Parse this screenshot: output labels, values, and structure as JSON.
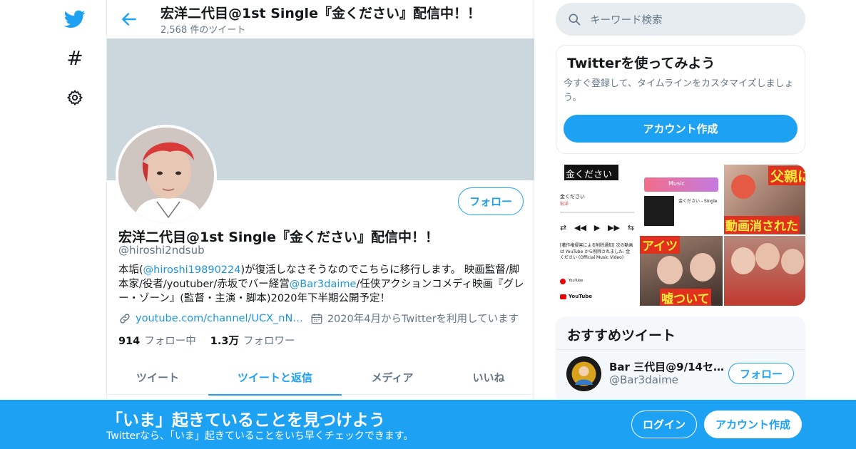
{
  "colors": {
    "accent": "#1da1f2",
    "banner": "#ccd6dd",
    "text_secondary": "#657786",
    "link": "#1b95e0"
  },
  "nav": {
    "items": [
      {
        "icon": "twitter-logo-icon"
      },
      {
        "icon": "hashtag-icon",
        "glyph": "#"
      },
      {
        "icon": "gear-icon"
      }
    ]
  },
  "header": {
    "back_icon": "arrow-left-icon",
    "title": "宏洋二代目@1st Single『金ください』配信中！！",
    "tweet_count": "2,568 件のツイート"
  },
  "profile": {
    "follow_label": "フォロー",
    "name": "宏洋二代目@1st Single『金ください』配信中！！",
    "handle": "@hiroshi2ndsub",
    "bio": {
      "p1": "本垢(",
      "link1": "@hiroshi19890224",
      "p2": ")が復活しなさそうなのでこちらに移行します。 映画監督/脚本家/役者/youtuber/赤坂でバー経営",
      "link2": "@Bar3daime",
      "p3": "/任侠アクションコメディ映画『グレー・ゾーン』(監督・主演・脚本)2020年下半期公開予定！"
    },
    "website": "youtube.com/channel/UCX_nN…",
    "joined": "2020年4月からTwitterを利用しています",
    "following_count": "914",
    "following_label": "フォロー中",
    "followers_count": "1.3万",
    "followers_label": "フォロワー"
  },
  "tabs": [
    {
      "label": "ツイート",
      "active": false
    },
    {
      "label": "ツイートと返信",
      "active": true
    },
    {
      "label": "メディア",
      "active": false
    },
    {
      "label": "いいね",
      "active": false
    }
  ],
  "search": {
    "placeholder": "キーワード検索"
  },
  "signup_card": {
    "title": "Twitterを使ってみよう",
    "description": "今すぐ登録して、タイムラインをカスタマイズしましょう。",
    "button": "アカウント作成"
  },
  "media": {
    "t1_title": "金ください",
    "t1_song": "金ください",
    "t1_artist": "宏洋",
    "t1_notice": "[著作権侵害による削除通知] 次の動画は YouTube から削除されました: 金ください (Official Music Video)",
    "t1_yt": "YouTube",
    "t1_yt2": "YouTube",
    "t2_music": "Music",
    "t2_song": "金ください - Single",
    "t3_cap1": "父親に",
    "t3_cap2": "動画消された",
    "t4_cap1": "アイツ",
    "t4_cap2": "嘘ついて"
  },
  "recommend": {
    "title": "おすすめツイート",
    "user_name": "Bar 三代目@9/14セ…",
    "user_handle": "@Bar3daime",
    "follow_label": "フォロー"
  },
  "bottom_bar": {
    "title": "「いま」起きていることを見つけよう",
    "subtitle": "Twitterなら、「いま」起きていることをいち早くチェックできます。",
    "login": "ログイン",
    "signup": "アカウント作成"
  }
}
